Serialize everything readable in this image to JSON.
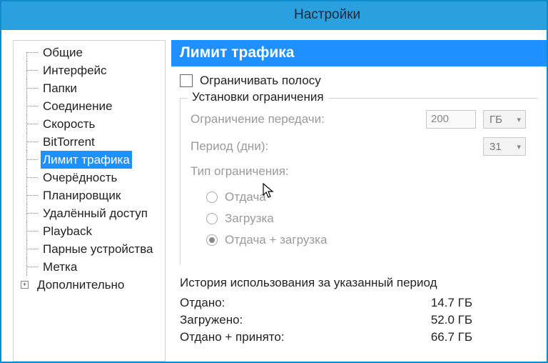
{
  "window": {
    "title": "Настройки"
  },
  "sidebar": {
    "items": [
      {
        "label": "Общие"
      },
      {
        "label": "Интерфейс"
      },
      {
        "label": "Папки"
      },
      {
        "label": "Соединение"
      },
      {
        "label": "Скорость"
      },
      {
        "label": "BitTorrent"
      },
      {
        "label": "Лимит трафика"
      },
      {
        "label": "Очерёдность"
      },
      {
        "label": "Планировщик"
      },
      {
        "label": "Удалённый доступ"
      },
      {
        "label": "Playback"
      },
      {
        "label": "Парные устройства"
      },
      {
        "label": "Метка"
      }
    ],
    "expandable": {
      "label": "Дополнительно"
    }
  },
  "main": {
    "heading": "Лимит трафика",
    "limit_checkbox_label": "Ограничивать полосу",
    "group_title": "Установки ограничения",
    "transfer_limit_label": "Ограничение передачи:",
    "transfer_limit_value": "200",
    "transfer_limit_unit": "ГБ",
    "period_label": "Период (дни):",
    "period_value": "31",
    "type_label": "Тип ограничения:",
    "radios": {
      "upload": "Отдача",
      "download": "Загрузка",
      "both": "Отдача + загрузка"
    },
    "history": {
      "title": "История использования за указанный период",
      "uploaded_label": "Отдано:",
      "uploaded_value": "14.7 ГБ",
      "downloaded_label": "Загружено:",
      "downloaded_value": "52.0 ГБ",
      "both_label": "Отдано + принято:",
      "both_value": "66.7 ГБ"
    }
  }
}
